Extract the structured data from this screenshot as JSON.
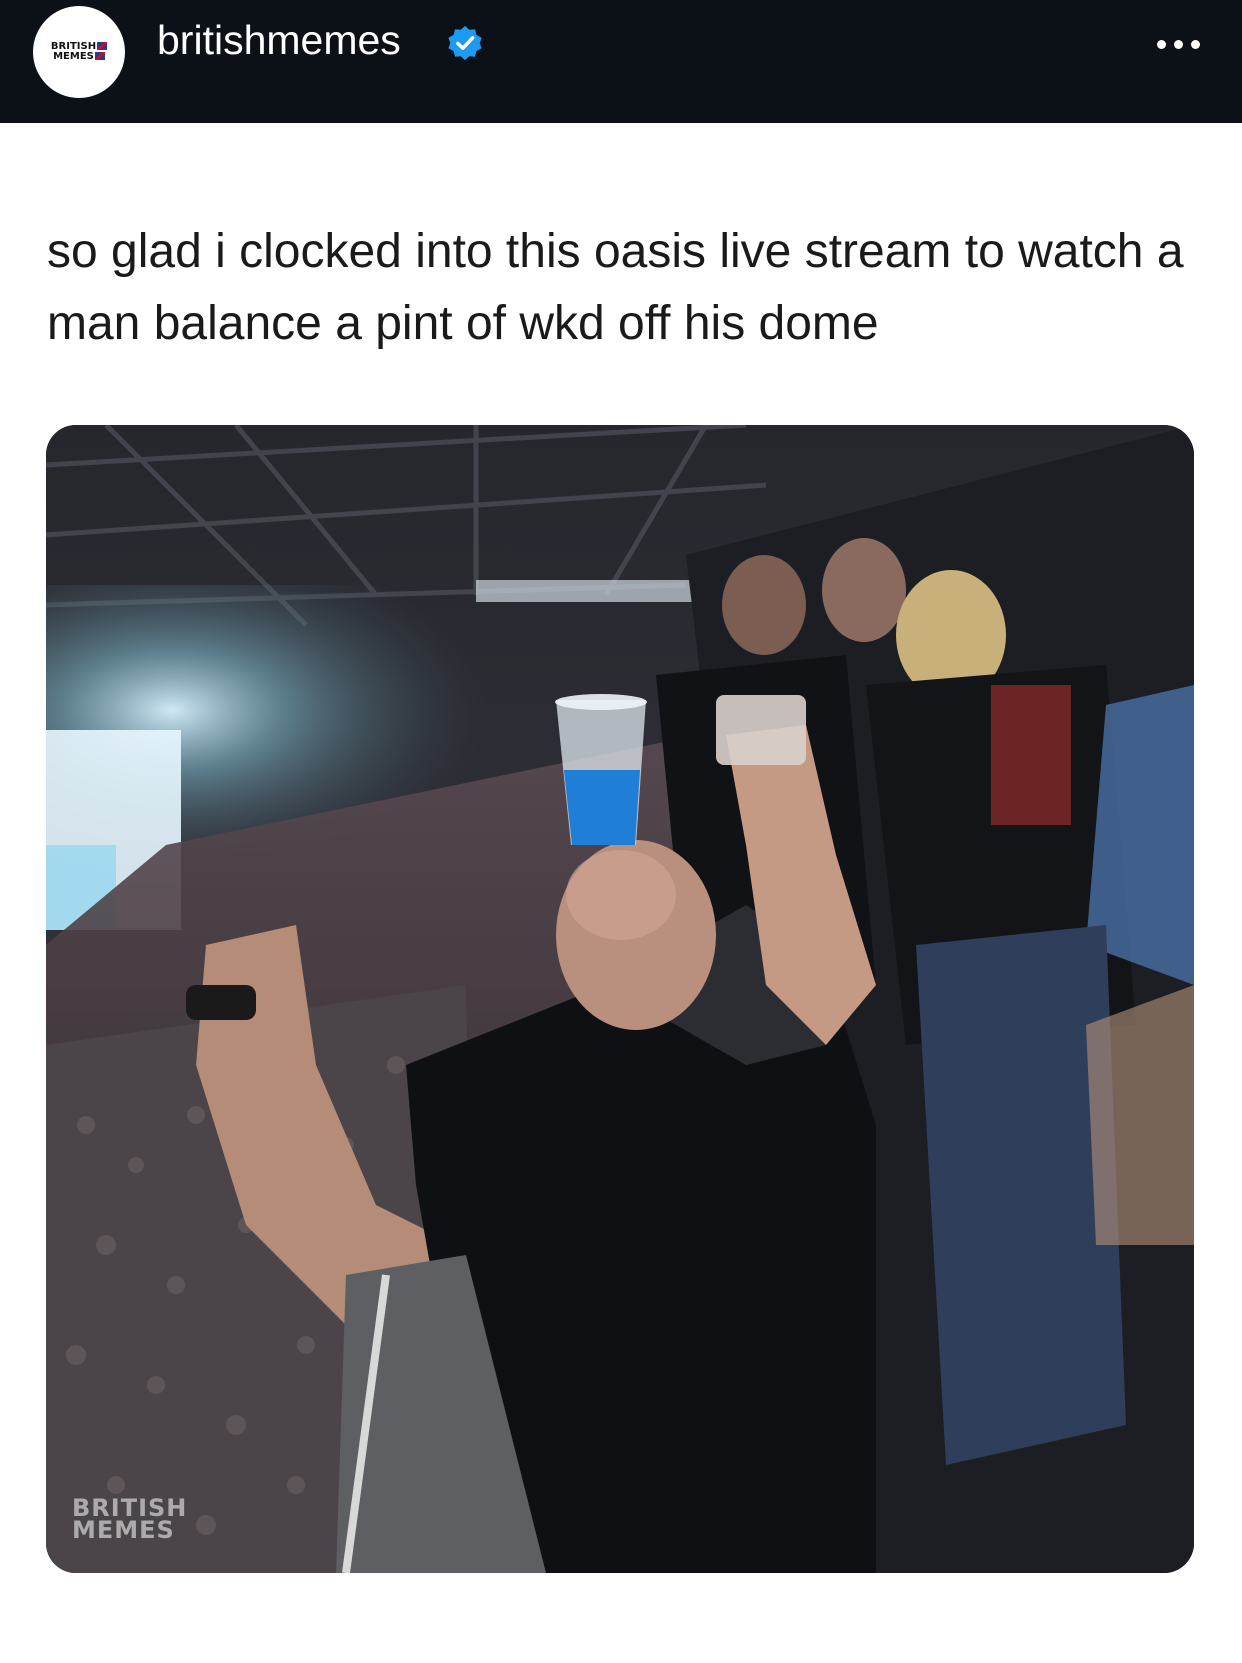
{
  "post": {
    "account": {
      "username": "britishmemes",
      "verified": true,
      "avatar_text_line1": "BRITISH",
      "avatar_text_line2": "MEMES"
    },
    "caption": "so glad i clocked into this oasis live stream to watch a man balance a pint of wkd off his dome",
    "media": {
      "watermark_line1": "BRITISH",
      "watermark_line2": "MEMES"
    }
  },
  "icons": {
    "verified": "verified-badge-icon",
    "more": "more-options-icon"
  },
  "colors": {
    "topbar": "#0b1117",
    "verified": "#1d9bf0",
    "caption_text": "#1a1a1a"
  }
}
